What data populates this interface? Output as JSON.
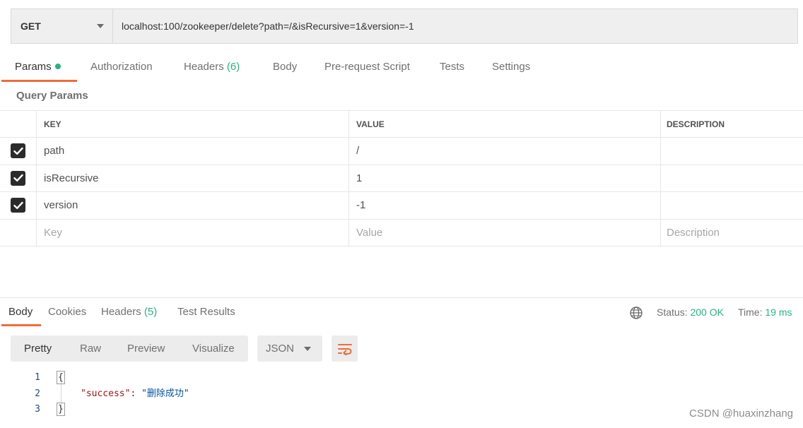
{
  "request": {
    "method": "GET",
    "url": "localhost:100/zookeeper/delete?path=/&isRecursive=1&version=-1"
  },
  "request_tabs": {
    "params": "Params",
    "authorization": "Authorization",
    "headers": "Headers",
    "headers_count": "(6)",
    "body": "Body",
    "prerequest": "Pre-request Script",
    "tests": "Tests",
    "settings": "Settings"
  },
  "query_params": {
    "title": "Query Params",
    "columns": {
      "key": "KEY",
      "value": "VALUE",
      "description": "DESCRIPTION"
    },
    "rows": [
      {
        "checked": true,
        "key": "path",
        "value": "/",
        "description": ""
      },
      {
        "checked": true,
        "key": "isRecursive",
        "value": "1",
        "description": ""
      },
      {
        "checked": true,
        "key": "version",
        "value": "-1",
        "description": ""
      }
    ],
    "placeholders": {
      "key": "Key",
      "value": "Value",
      "description": "Description"
    }
  },
  "response_tabs": {
    "body": "Body",
    "cookies": "Cookies",
    "headers": "Headers",
    "headers_count": "(5)",
    "test_results": "Test Results"
  },
  "response_status": {
    "status_label": "Status:",
    "status_value": "200 OK",
    "time_label": "Time:",
    "time_value": "19 ms"
  },
  "format_tabs": {
    "pretty": "Pretty",
    "raw": "Raw",
    "preview": "Preview",
    "visualize": "Visualize",
    "format_select": "JSON"
  },
  "response_body": {
    "lines": [
      {
        "num": "1",
        "open": "{"
      },
      {
        "num": "2",
        "key": "\"success\"",
        "sep": ": ",
        "value": "\"删除成功\""
      },
      {
        "num": "3",
        "close": "}"
      }
    ]
  },
  "watermark": "CSDN @huaxinzhang",
  "colors": {
    "accent": "#f26b3a",
    "success_green": "#26b47f"
  }
}
